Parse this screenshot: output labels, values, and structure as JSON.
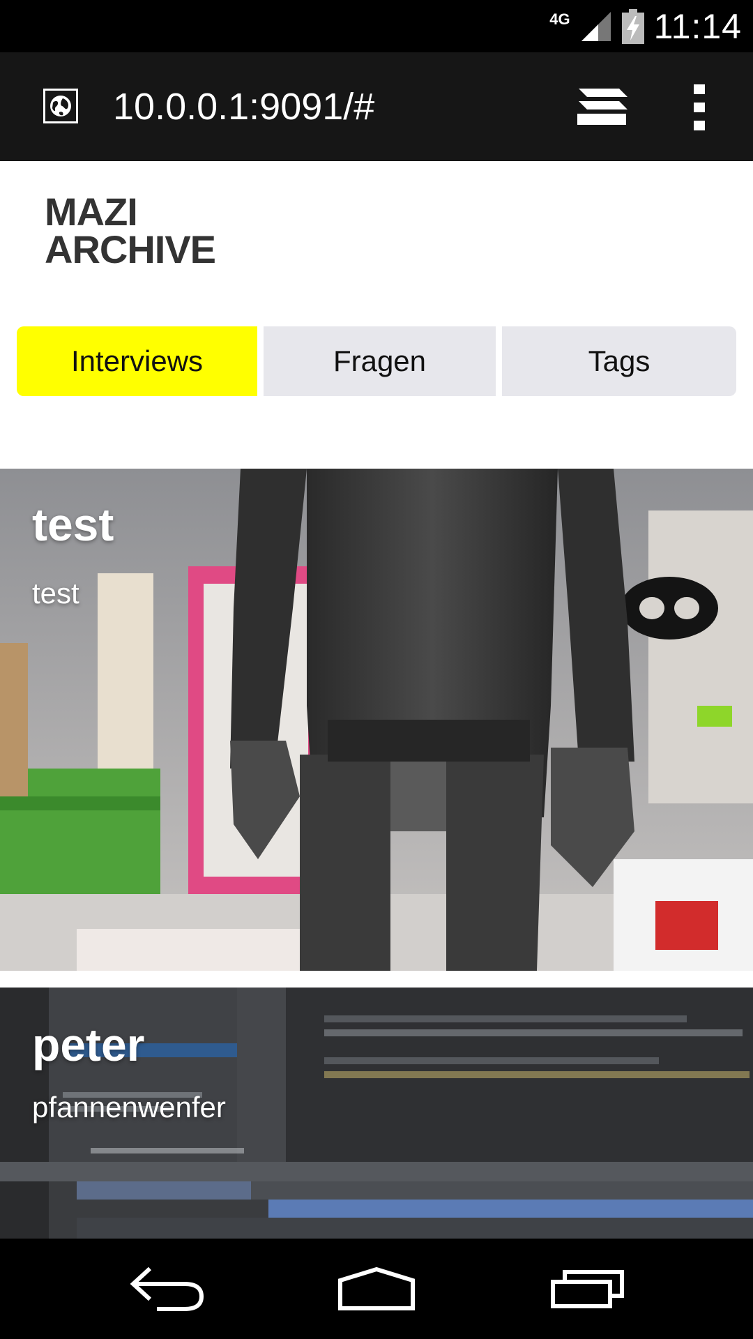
{
  "status_bar": {
    "network_type": "4G",
    "time": "11:14",
    "icons": [
      "signal-icon",
      "battery-charging-icon"
    ]
  },
  "browser": {
    "url": "10.0.0.1:9091/#",
    "icons": [
      "globe-icon",
      "tabs-icon",
      "overflow-menu-icon"
    ]
  },
  "header": {
    "logo_line1": "MAZI",
    "logo_line2": "ARCHIVE"
  },
  "tabs": [
    {
      "label": "Interviews",
      "active": true
    },
    {
      "label": "Fragen",
      "active": false
    },
    {
      "label": "Tags",
      "active": false
    }
  ],
  "cards": [
    {
      "title": "test",
      "subtitle": "test"
    },
    {
      "title": "peter",
      "subtitle": "pfannenwenfer"
    }
  ],
  "colors": {
    "active_tab": "#ffff00",
    "inactive_tab": "#e7e7ec",
    "url_bar": "#161616",
    "logo_text": "#333333"
  },
  "nav_bar": {
    "icons": [
      "back-icon",
      "home-icon",
      "recents-icon"
    ]
  }
}
